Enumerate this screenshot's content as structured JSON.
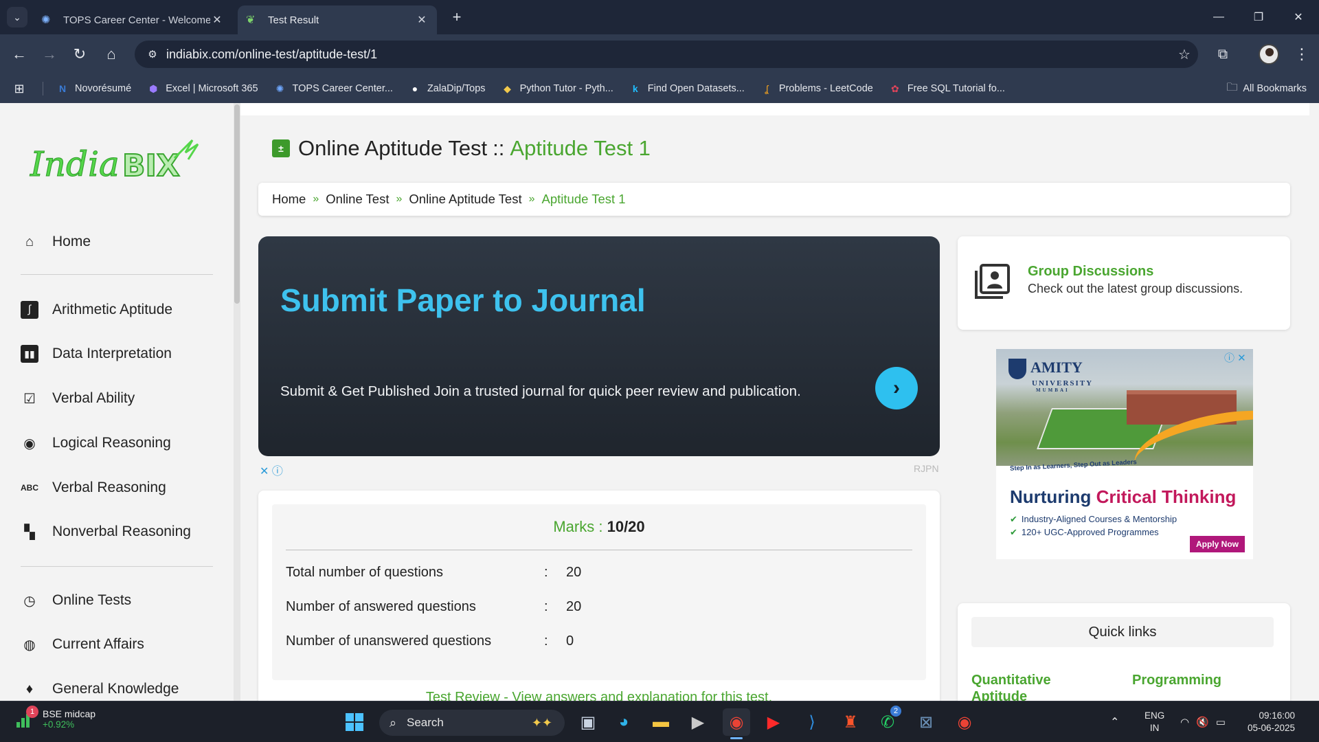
{
  "browser": {
    "tabs": [
      {
        "title": "TOPS Career Center - Welcome",
        "active": false,
        "icon": "tops-gear-icon"
      },
      {
        "title": "Test Result",
        "active": true,
        "icon": "indiabix-leaf-icon"
      }
    ],
    "url": "indiabix.com/online-test/aptitude-test/1",
    "bookmarks": [
      {
        "label": "Novorésumé",
        "icon": "novoresume-icon",
        "color": "#3a7bd5"
      },
      {
        "label": "Excel | Microsoft 365",
        "icon": "microsoft365-icon",
        "color": "#7b61ff"
      },
      {
        "label": "TOPS Career Center...",
        "icon": "tops-gear-icon",
        "color": "#6fa8ff"
      },
      {
        "label": "ZalaDip/Tops",
        "icon": "github-icon",
        "color": "#ffffff"
      },
      {
        "label": "Python Tutor - Pyth...",
        "icon": "python-icon",
        "color": "#f2c94c"
      },
      {
        "label": "Find Open Datasets...",
        "icon": "kaggle-icon",
        "color": "#20beff"
      },
      {
        "label": "Problems - LeetCode",
        "icon": "leetcode-icon",
        "color": "#f0a020"
      },
      {
        "label": "Free SQL Tutorial fo...",
        "icon": "sql-tutorial-icon",
        "color": "#e0445a"
      }
    ],
    "all_bookmarks": "All Bookmarks"
  },
  "sidebar": {
    "logo_text": "IndiaBIX",
    "items": [
      {
        "label": "Home",
        "icon": "home-icon"
      },
      {
        "label": "Arithmetic Aptitude",
        "icon": "integral-icon"
      },
      {
        "label": "Data Interpretation",
        "icon": "bar-chart-icon"
      },
      {
        "label": "Verbal Ability",
        "icon": "checklist-icon"
      },
      {
        "label": "Logical Reasoning",
        "icon": "aperture-icon"
      },
      {
        "label": "Verbal Reasoning",
        "icon": "abc-icon"
      },
      {
        "label": "Nonverbal Reasoning",
        "icon": "dashboard-icon"
      },
      {
        "label": "Online Tests",
        "icon": "clock-icon"
      },
      {
        "label": "Current Affairs",
        "icon": "globe-icon"
      },
      {
        "label": "General Knowledge",
        "icon": "bulb-icon"
      }
    ]
  },
  "page": {
    "title_main": "Online Aptitude Test",
    "title_sep": "::",
    "title_highlight": "Aptitude Test 1",
    "breadcrumb": [
      "Home",
      "Online Test",
      "Online Aptitude Test",
      "Aptitude Test 1"
    ],
    "breadcrumb_arrow": "»"
  },
  "ad_banner": {
    "title": "Submit Paper to Journal",
    "text": "Submit & Get Published Join a trusted journal for quick peer review and publication.",
    "badges": "✕ ⓘ",
    "by": "RJPN"
  },
  "result": {
    "marks_label": "Marks :",
    "marks_value": "10/20",
    "colon": ":",
    "rows": [
      {
        "label": "Total number of questions",
        "value": "20"
      },
      {
        "label": "Number of answered questions",
        "value": "20"
      },
      {
        "label": "Number of unanswered questions",
        "value": "0"
      }
    ],
    "review_link": "Test Review - View answers and explanation for this test."
  },
  "group_discussions": {
    "title": "Group Discussions",
    "subtitle": "Check out the latest group discussions."
  },
  "amity_ad": {
    "logo": "AMITY",
    "logo_sub": "UNIVERSITY",
    "campus": "MUMBAI",
    "tagline": "Step In as Learners, Step Out as Leaders",
    "headline_a": "Nurturing",
    "headline_b": "Critical Thinking",
    "bullets": [
      "Industry-Aligned Courses & Mentorship",
      "120+ UGC-Approved Programmes"
    ],
    "apply": "Apply Now",
    "badges": "ⓘ ✕"
  },
  "quick_links": {
    "heading": "Quick links",
    "links": [
      "Quantitative Aptitude",
      "Programming"
    ]
  },
  "taskbar": {
    "stock_name": "BSE midcap",
    "stock_change": "+0.92%",
    "stock_badge": "1",
    "search_label": "Search",
    "whatsapp_badge": "2",
    "lang_1": "ENG",
    "lang_2": "IN",
    "time": "09:16:00",
    "date": "05-06-2025"
  }
}
